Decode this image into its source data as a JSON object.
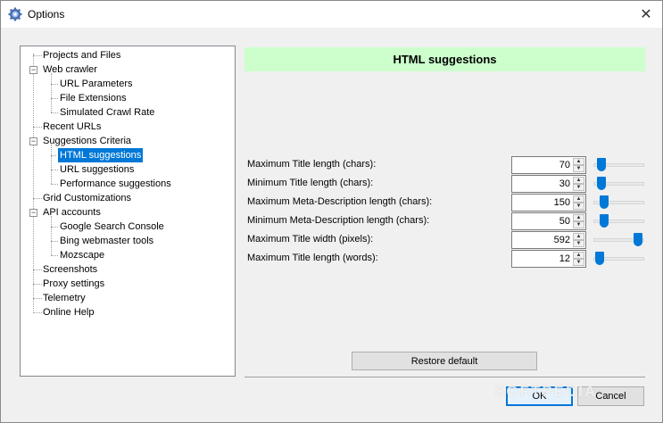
{
  "window": {
    "title": "Options",
    "close_glyph": "✕",
    "watermark": "SOFTPEDIA"
  },
  "tree": {
    "items": [
      {
        "label": "Projects and Files"
      },
      {
        "label": "Web crawler"
      },
      {
        "label": "URL Parameters"
      },
      {
        "label": "File Extensions"
      },
      {
        "label": "Simulated Crawl Rate"
      },
      {
        "label": "Recent URLs"
      },
      {
        "label": "Suggestions Criteria"
      },
      {
        "label": "HTML suggestions"
      },
      {
        "label": "URL suggestions"
      },
      {
        "label": "Performance suggestions"
      },
      {
        "label": "Grid Customizations"
      },
      {
        "label": "API accounts"
      },
      {
        "label": "Google Search Console"
      },
      {
        "label": "Bing webmaster tools"
      },
      {
        "label": "Mozscape"
      },
      {
        "label": "Screenshots"
      },
      {
        "label": "Proxy settings"
      },
      {
        "label": "Telemetry"
      },
      {
        "label": "Online Help"
      }
    ],
    "expander_glyph": "−",
    "selected": "HTML suggestions"
  },
  "panel": {
    "header": "HTML suggestions",
    "header_color": "#ccffcc",
    "settings": [
      {
        "label": "Maximum Title length (chars):",
        "value": "70",
        "slider_fraction": 0.08
      },
      {
        "label": "Minimum Title length (chars):",
        "value": "30",
        "slider_fraction": 0.08
      },
      {
        "label": "Maximum Meta-Description length (chars):",
        "value": "150",
        "slider_fraction": 0.15
      },
      {
        "label": "Minimum Meta-Description length (chars):",
        "value": "50",
        "slider_fraction": 0.15
      },
      {
        "label": "Maximum Title width (pixels):",
        "value": "592",
        "slider_fraction": 0.95
      },
      {
        "label": "Maximum Title length (words):",
        "value": "12",
        "slider_fraction": 0.04
      }
    ],
    "restore_label": "Restore default"
  },
  "footer": {
    "ok_label": "OK",
    "cancel_label": "Cancel"
  },
  "colors": {
    "accent": "#0078d7",
    "selection": "#0078d7"
  }
}
